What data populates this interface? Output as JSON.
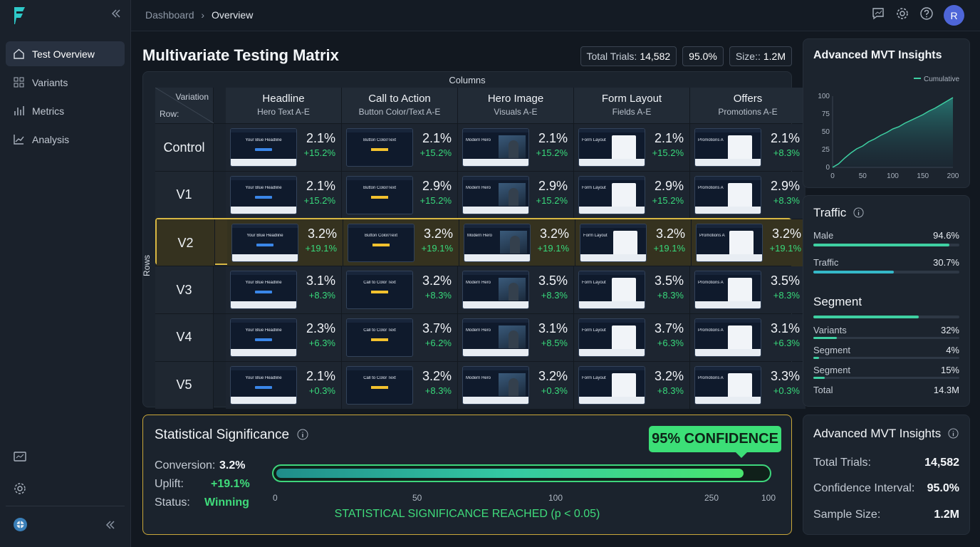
{
  "breadcrumb": {
    "root": "Dashboard",
    "current": "Overview"
  },
  "user": {
    "initial": "R"
  },
  "sidebar": {
    "items": [
      {
        "label": "Test Overview",
        "icon": "home-icon"
      },
      {
        "label": "Variants",
        "icon": "grid-icon"
      },
      {
        "label": "Metrics",
        "icon": "bar-chart-icon"
      },
      {
        "label": "Analysis",
        "icon": "line-chart-icon"
      }
    ]
  },
  "page": {
    "title": "Multivariate Testing Matrix"
  },
  "chips": {
    "trials_label": "Total Trials:",
    "trials_value": "14,582",
    "confidence": "95.0%",
    "size_label": "Size::",
    "size_value": "1.2M"
  },
  "matrix": {
    "columns_label": "Columns",
    "rows_label": "Rows",
    "corner_col": "Variation",
    "corner_row": "Row:",
    "columns": [
      {
        "title": "Headline",
        "sub": "Hero Text A-E"
      },
      {
        "title": "Call to Action",
        "sub": "Button Color/Text A-E"
      },
      {
        "title": "Hero Image",
        "sub": "Visuals A-E"
      },
      {
        "title": "Form Layout",
        "sub": "Fields A-E"
      },
      {
        "title": "Offers",
        "sub": "Promotions A-E"
      }
    ],
    "rows": [
      {
        "label": "Control",
        "cells": [
          {
            "thumb": "Your Blue Headline",
            "p": "2.1%",
            "u": "+15.2%"
          },
          {
            "thumb": "Button Color/Text",
            "p": "2.1%",
            "u": "+15.2%"
          },
          {
            "thumb": "Modern Hero",
            "p": "2.1%",
            "u": "+15.2%"
          },
          {
            "thumb": "Form Layout",
            "p": "2.1%",
            "u": "+15.2%"
          },
          {
            "thumb": "Promotions A",
            "p": "2.1%",
            "u": "+8.3%"
          }
        ]
      },
      {
        "label": "V1",
        "cells": [
          {
            "thumb": "Your Blue Headline",
            "p": "2.1%",
            "u": "+15.2%"
          },
          {
            "thumb": "Button Color/Text",
            "p": "2.9%",
            "u": "+15.2%"
          },
          {
            "thumb": "Modern Hero",
            "p": "2.9%",
            "u": "+15.2%"
          },
          {
            "thumb": "Form Layout",
            "p": "2.9%",
            "u": "+15.2%"
          },
          {
            "thumb": "Promotions A",
            "p": "2.9%",
            "u": "+8.3%"
          }
        ]
      },
      {
        "label": "V2",
        "cells": [
          {
            "thumb": "Your Blue Headline",
            "p": "3.2%",
            "u": "+19.1%"
          },
          {
            "thumb": "Button Color/Text",
            "p": "3.2%",
            "u": "+19.1%"
          },
          {
            "thumb": "Modern Hero",
            "p": "3.2%",
            "u": "+19.1%"
          },
          {
            "thumb": "Form Layout",
            "p": "3.2%",
            "u": "+19.1%"
          },
          {
            "thumb": "Promotions A",
            "p": "3.2%",
            "u": "+19.1%"
          }
        ]
      },
      {
        "label": "V3",
        "cells": [
          {
            "thumb": "Your Blue Headline",
            "p": "3.1%",
            "u": "+8.3%"
          },
          {
            "thumb": "Call to Color Text",
            "p": "3.2%",
            "u": "+8.3%"
          },
          {
            "thumb": "Modern Hero",
            "p": "3.5%",
            "u": "+8.3%"
          },
          {
            "thumb": "Form Layout",
            "p": "3.5%",
            "u": "+8.3%"
          },
          {
            "thumb": "Promotions A",
            "p": "3.5%",
            "u": "+8.3%"
          }
        ]
      },
      {
        "label": "V4",
        "cells": [
          {
            "thumb": "Your Blue Headline",
            "p": "2.3%",
            "u": "+6.3%"
          },
          {
            "thumb": "Call to Color Text",
            "p": "3.7%",
            "u": "+6.2%"
          },
          {
            "thumb": "Modern Hero",
            "p": "3.1%",
            "u": "+8.5%"
          },
          {
            "thumb": "Form Layout",
            "p": "3.7%",
            "u": "+6.3%"
          },
          {
            "thumb": "Promotions A",
            "p": "3.1%",
            "u": "+6.3%"
          }
        ]
      },
      {
        "label": "V5",
        "cells": [
          {
            "thumb": "Your Blue Headline",
            "p": "2.1%",
            "u": "+0.3%"
          },
          {
            "thumb": "Call to Color Text",
            "p": "3.2%",
            "u": "+8.3%"
          },
          {
            "thumb": "Modern Hero",
            "p": "3.2%",
            "u": "+0.3%"
          },
          {
            "thumb": "Form Layout",
            "p": "3.2%",
            "u": "+8.3%"
          },
          {
            "thumb": "Promotions A",
            "p": "3.3%",
            "u": "+0.3%"
          }
        ]
      }
    ]
  },
  "significance": {
    "title": "Statistical Significance",
    "conversion_label": "Conversion:",
    "conversion_value": "3.2%",
    "uplift_label": "Uplift:",
    "uplift_value": "+19.1%",
    "status_label": "Status:",
    "status_value": "Winning",
    "badge": "95% CONFIDENCE",
    "progress": 0.96,
    "ticks": [
      "0",
      "50",
      "100",
      "250",
      "100"
    ],
    "message": "STATISTICAL SIGNIFICANCE REACHED (p < 0.05)"
  },
  "insights_chart": {
    "title": "Advanced MVT Insights",
    "legend": "Cumulative"
  },
  "chart_data": {
    "type": "area",
    "series": [
      {
        "name": "Cumulative",
        "x": [
          0,
          10,
          20,
          30,
          40,
          50,
          60,
          70,
          80,
          90,
          100,
          110,
          120,
          130,
          140,
          150,
          160,
          170,
          180,
          190,
          200
        ],
        "values": [
          0,
          5,
          13,
          20,
          26,
          30,
          36,
          40,
          45,
          49,
          54,
          57,
          62,
          66,
          70,
          74,
          79,
          83,
          88,
          93,
          98
        ]
      }
    ],
    "xlim": [
      0,
      200
    ],
    "ylim": [
      0,
      100
    ],
    "xticks": [
      "0",
      "50",
      "100",
      "150",
      "200"
    ],
    "yticks": [
      "100",
      "75",
      "50",
      "25",
      "0"
    ]
  },
  "traffic": {
    "title": "Traffic",
    "items": [
      {
        "label": "Male",
        "value": "94.6%",
        "fill": 0.93,
        "color": "#3ed0a2"
      },
      {
        "label": "Traffic",
        "value": "30.7%",
        "fill": 0.55,
        "color": "#35b8c8"
      }
    ]
  },
  "segment": {
    "title": "Segment",
    "top_fill": 0.72,
    "items": [
      {
        "label": "Variants",
        "value": "32%",
        "fill": 0.16
      },
      {
        "label": "Segment",
        "value": "4%",
        "fill": 0.04
      },
      {
        "label": "Segment",
        "value": "15%",
        "fill": 0.08
      },
      {
        "label": "Total",
        "value": "14.3M"
      }
    ]
  },
  "summary": {
    "title": "Advanced MVT Insights",
    "items": [
      {
        "label": "Total Trials:",
        "value": "14,582"
      },
      {
        "label": "Confidence Interval:",
        "value": "95.0%"
      },
      {
        "label": "Sample Size:",
        "value": "1.2M"
      }
    ]
  }
}
